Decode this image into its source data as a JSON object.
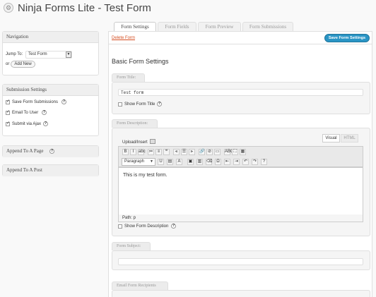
{
  "header": {
    "title": "Ninja Forms Lite - Test Form",
    "icon": "ninja-forms-icon"
  },
  "tabs": [
    {
      "label": "Form Settings",
      "active": true
    },
    {
      "label": "Form Fields",
      "active": false
    },
    {
      "label": "Form Preview",
      "active": false
    },
    {
      "label": "Form Submissions",
      "active": false
    }
  ],
  "toolbar": {
    "delete_label": "Delete Form",
    "save_label": "Save Form Settings"
  },
  "sidebar": {
    "navigation": {
      "title": "Navigation",
      "jump_label": "Jump To:",
      "jump_value": "Test Form",
      "or_label": "or",
      "add_new_label": "Add New"
    },
    "submission": {
      "title": "Submission Settings",
      "items": [
        {
          "label": "Save Form Submissions",
          "checked": true
        },
        {
          "label": "Email To User",
          "checked": true
        },
        {
          "label": "Submit via Ajax",
          "checked": true
        }
      ]
    },
    "append_page": {
      "title": "Append To A Page"
    },
    "append_post": {
      "title": "Append To A Post"
    }
  },
  "main": {
    "heading": "Basic Form Settings",
    "form_title": {
      "tab_label": "Form Title:",
      "value": "Test form",
      "show_label": "Show Form Title"
    },
    "form_description": {
      "tab_label": "Form Description:",
      "upload_label": "Upload/Insert",
      "visual_label": "Visual",
      "html_label": "HTML",
      "format_value": "Paragraph",
      "content": "This is my test form.",
      "path_label": "Path: p",
      "show_label": "Show Form Description"
    },
    "form_subject": {
      "tab_label": "Form Subject:",
      "value": ""
    },
    "email_recipients": {
      "tab_label": "Email Form Recipients"
    }
  },
  "editor_tools_row1": [
    "B",
    "I",
    "abc",
    "≔",
    "≡",
    "❝",
    "⫷",
    "☰",
    "⫸",
    "🔗",
    "⊘",
    "▭",
    "ABC",
    "⛶",
    "▦"
  ],
  "editor_tools_row2": [
    "U",
    "▤",
    "A",
    "▣",
    "▥",
    "⌫",
    "Ω",
    "⇤",
    "⇥",
    "↶",
    "↷",
    "?"
  ],
  "colors": {
    "accent": "#21759b",
    "delete": "#d54e21"
  }
}
